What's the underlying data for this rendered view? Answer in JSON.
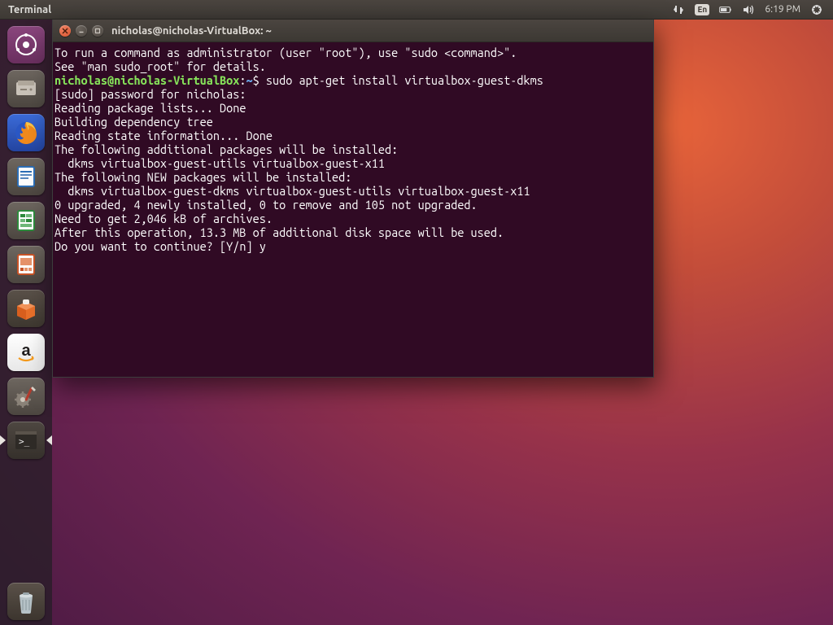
{
  "menubar": {
    "app_label": "Terminal",
    "lang": "En",
    "clock": "6:19 PM"
  },
  "launcher": {
    "items": [
      {
        "name": "dash-icon"
      },
      {
        "name": "files-icon"
      },
      {
        "name": "firefox-icon"
      },
      {
        "name": "writer-icon"
      },
      {
        "name": "calc-icon"
      },
      {
        "name": "impress-icon"
      },
      {
        "name": "software-icon"
      },
      {
        "name": "amazon-icon"
      },
      {
        "name": "settings-icon"
      },
      {
        "name": "terminal-icon"
      }
    ],
    "trash": {
      "name": "trash-icon"
    }
  },
  "terminal": {
    "title": "nicholas@nicholas-VirtualBox: ~",
    "prompt": {
      "user": "nicholas",
      "at": "@",
      "host": "nicholas-VirtualBox",
      "colon": ":",
      "path": "~",
      "dollar": "$"
    },
    "command": "sudo apt-get install virtualbox-guest-dkms",
    "pre_lines": [
      "To run a command as administrator (user \"root\"), use \"sudo <command>\".",
      "See \"man sudo_root\" for details.",
      ""
    ],
    "post_lines": [
      "[sudo] password for nicholas:",
      "Reading package lists... Done",
      "Building dependency tree",
      "Reading state information... Done",
      "The following additional packages will be installed:",
      "  dkms virtualbox-guest-utils virtualbox-guest-x11",
      "The following NEW packages will be installed:",
      "  dkms virtualbox-guest-dkms virtualbox-guest-utils virtualbox-guest-x11",
      "0 upgraded, 4 newly installed, 0 to remove and 105 not upgraded.",
      "Need to get 2,046 kB of archives.",
      "After this operation, 13.3 MB of additional disk space will be used.",
      "Do you want to continue? [Y/n] y"
    ]
  }
}
